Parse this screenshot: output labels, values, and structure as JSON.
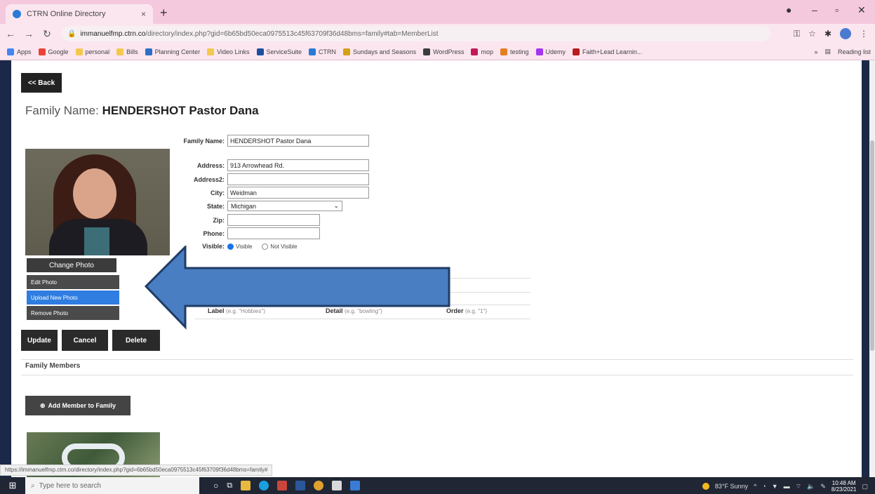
{
  "browser": {
    "tab_title": "CTRN Online Directory",
    "tab_close": "×",
    "new_tab": "+",
    "url_host": "immanuelfmp.ctrn.co",
    "url_path": "/directory/index.php?gid=6b65bd50eca0975513c45f63709f36d48bms=family#tab=MemberList",
    "bookmarks": [
      "Apps",
      "Google",
      "personal",
      "Bills",
      "Planning Center",
      "Video Links",
      "ServiceSuite",
      "CTRN",
      "Sundays and Seasons",
      "WordPress",
      "mop",
      "testing",
      "Udemy",
      "Faith+Lead Learnin..."
    ],
    "reading_list": "Reading list"
  },
  "page": {
    "back_label": "<< Back",
    "title_prefix": "Family Name:",
    "title_name": "HENDERSHOT Pastor Dana",
    "change_photo": "Change Photo",
    "photo_menu": [
      "Edit Photo",
      "Upload New Photo",
      "Remove Photo"
    ],
    "form": {
      "family_name_label": "Family Name:",
      "family_name_value": "HENDERSHOT Pastor Dana",
      "address_label": "Address:",
      "address_value": "913 Arrowhead Rd.",
      "address2_label": "Address2:",
      "address2_value": "",
      "city_label": "City:",
      "city_value": "Weidman",
      "state_label": "State:",
      "state_value": "Michigan",
      "zip_label": "Zip:",
      "zip_value": "",
      "phone_label": "Phone:",
      "phone_value": "",
      "visible_label": "Visible:",
      "visible_option": "Visible",
      "not_visible_option": "Not Visible"
    },
    "details_header": {
      "label": "Label",
      "label_hint": "(e.g. \"Hobbies\")",
      "detail": "Detail",
      "detail_hint": "(e.g. \"bowling\")",
      "order": "Order",
      "order_hint": "(e.g. \"1\")"
    },
    "buttons": {
      "update": "Update",
      "cancel": "Cancel",
      "delete": "Delete"
    },
    "family_members_header": "Family Members",
    "add_member": "Add Member to Family"
  },
  "status_url": "https://immanuelfmp.ctrn.co/directory/index.php?gid=6b65bd50eca0975513c45f63709f36d48bms=family#",
  "taskbar": {
    "search_placeholder": "Type here to search",
    "weather": "83°F Sunny",
    "time": "10:48 AM",
    "date": "8/23/2021"
  },
  "colors": {
    "tab_bar": "#f4c9dd",
    "frame": "#1b2848",
    "menu_active": "#2f7de0",
    "arrow_fill": "#4a7ec2",
    "arrow_stroke": "#1f3c66"
  }
}
